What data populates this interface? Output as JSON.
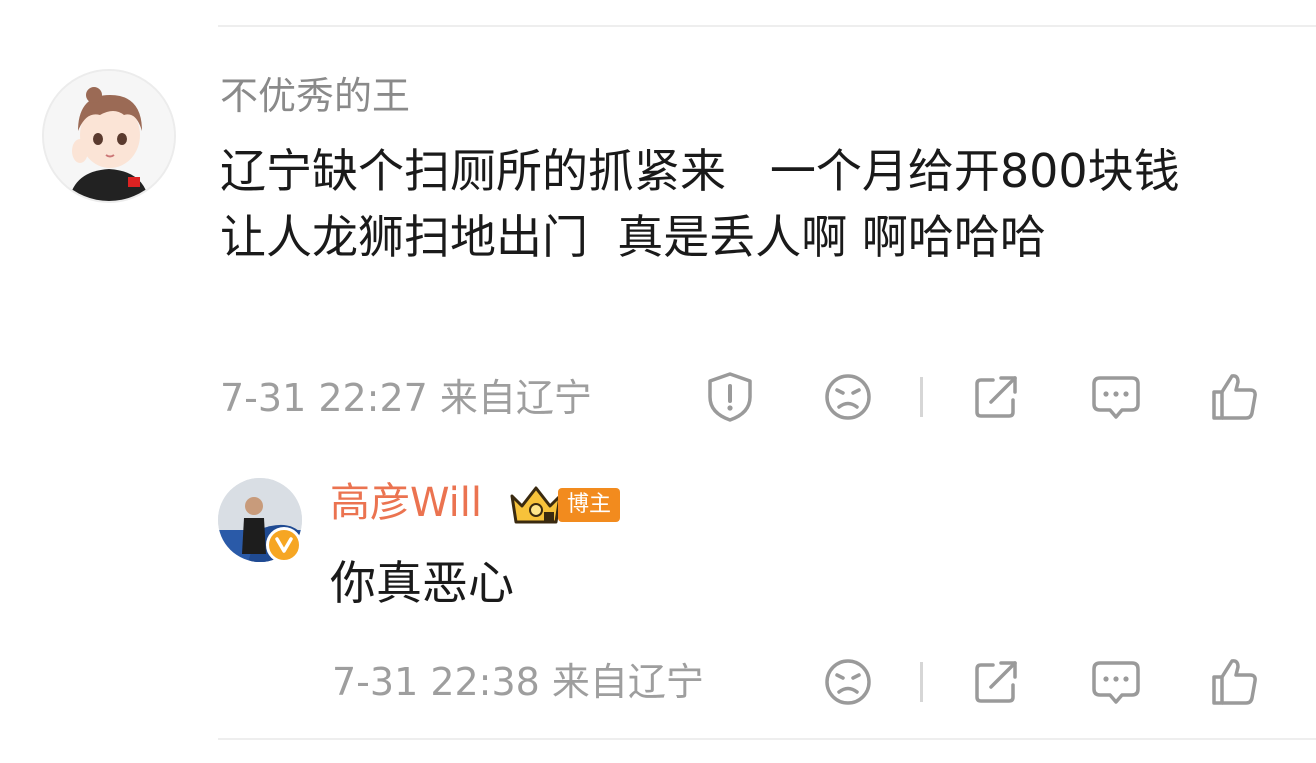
{
  "comment": {
    "username": "不优秀的王",
    "content": "辽宁缺个扫厕所的抓紧来   一个月给开800块钱     让人龙狮扫地出门  真是丢人啊 啊哈哈哈",
    "timestamp": "7-31 22:27",
    "location": "来自辽宁",
    "meta": "7-31 22:27  来自辽宁",
    "actions": [
      "report-icon",
      "dislike-icon",
      "share-icon",
      "comment-icon",
      "like-icon"
    ]
  },
  "reply": {
    "username": "高彦Will",
    "badge_label": "博主",
    "content": "你真恶心",
    "timestamp": "7-31 22:38",
    "location": "来自辽宁",
    "meta": "7-31 22:38  来自辽宁",
    "actions": [
      "dislike-icon",
      "share-icon",
      "comment-icon",
      "like-icon"
    ]
  },
  "colors": {
    "username_gray": "#8a8a8a",
    "author_orange": "#eb7350",
    "badge_orange": "#f28b1e",
    "meta_gray": "#9e9e9e",
    "icon_gray": "#9a9a9a"
  }
}
